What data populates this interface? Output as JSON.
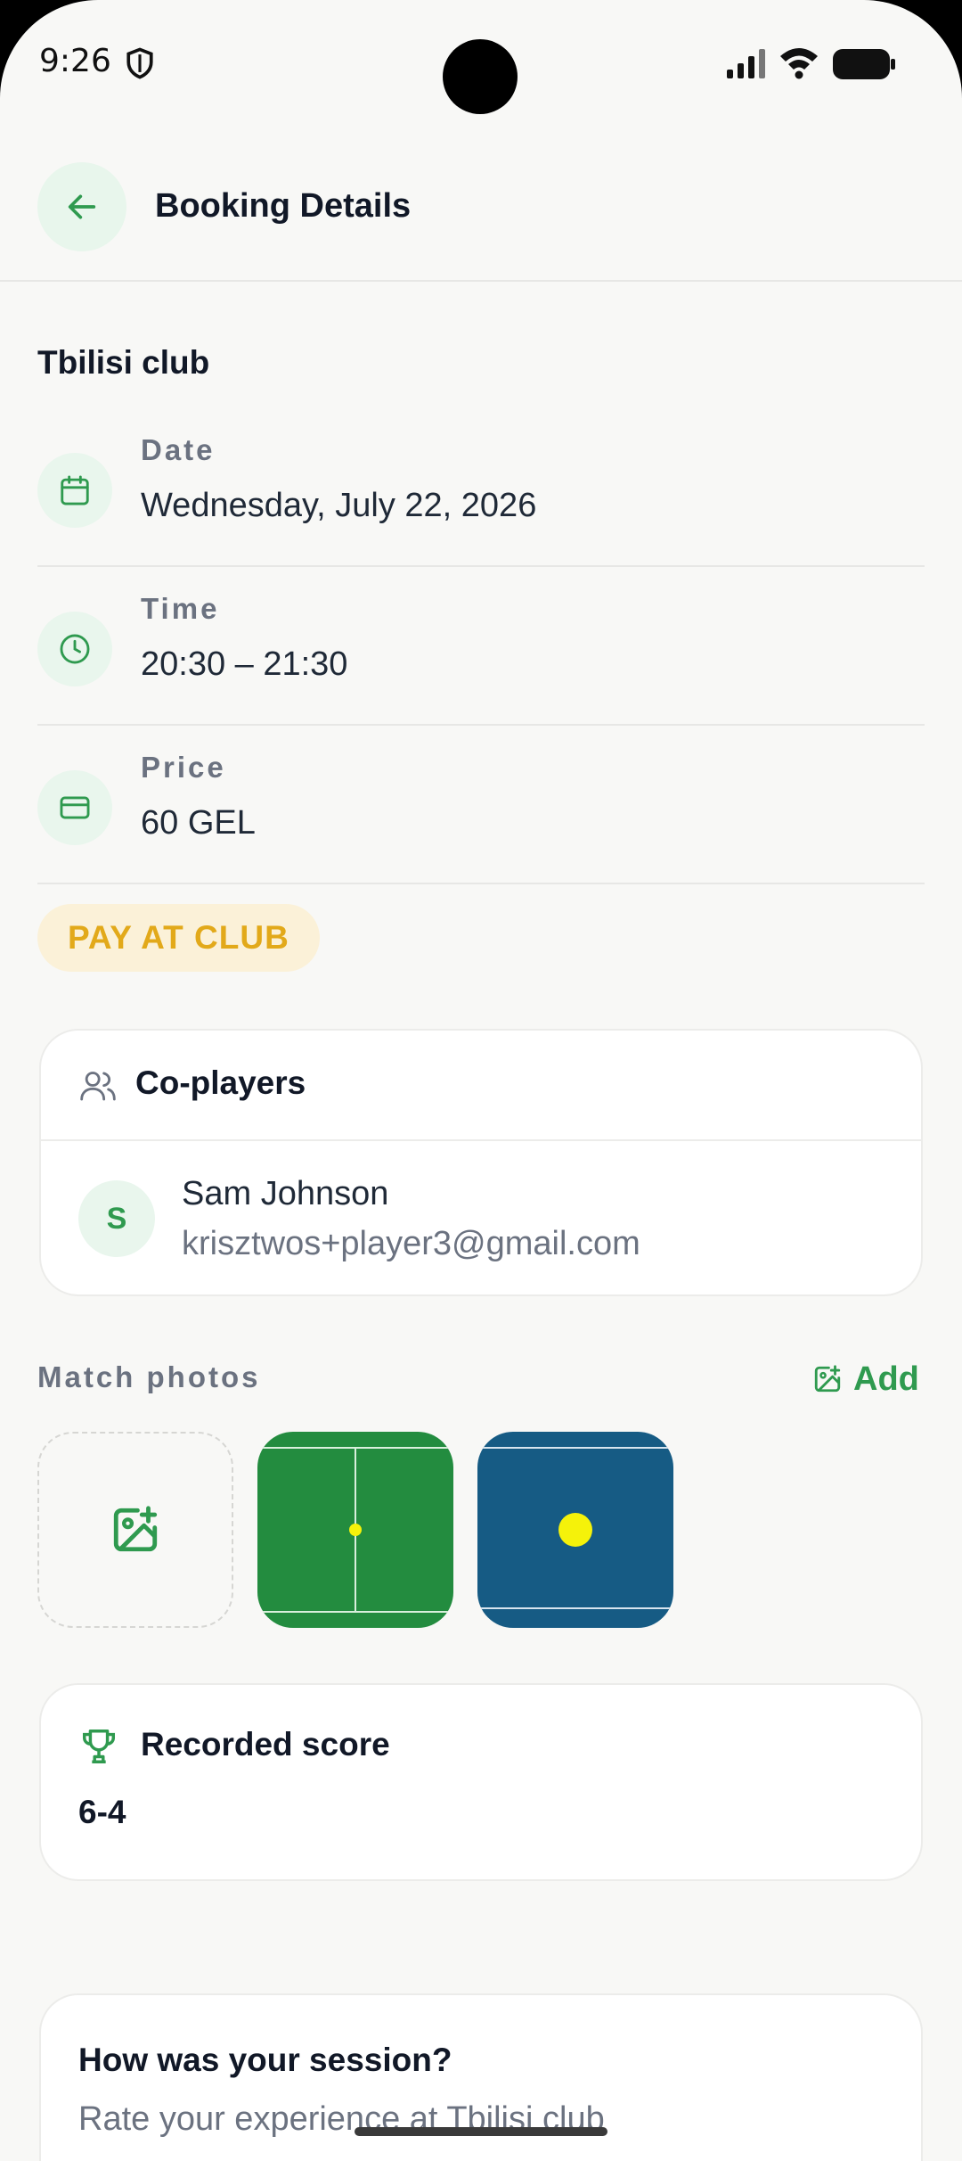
{
  "status_bar": {
    "time": "9:26"
  },
  "header": {
    "title": "Booking Details"
  },
  "club_name": "Tbilisi club",
  "details": [
    {
      "label": "Date",
      "value": "Wednesday, July 22, 2026",
      "icon": "calendar-icon"
    },
    {
      "label": "Time",
      "value": "20:30 – 21:30",
      "icon": "clock-icon"
    },
    {
      "label": "Price",
      "value": "60 GEL",
      "icon": "credit-card-icon"
    }
  ],
  "payment_badge": "PAY AT CLUB",
  "coplayers": {
    "title": "Co-players",
    "players": [
      {
        "initial": "S",
        "name": "Sam Johnson",
        "email": "krisztwos+player3@gmail.com"
      }
    ]
  },
  "photos": {
    "label": "Match photos",
    "add_label": "Add"
  },
  "score": {
    "title": "Recorded score",
    "value": "6-4"
  },
  "session": {
    "title": "How was your session?",
    "subtitle": "Rate your experience at Tbilisi club"
  },
  "colors": {
    "accent": "#2f9a4f",
    "badge_text": "#e2a91a",
    "badge_bg": "#fbf1d8",
    "background": "#f8f8f6"
  }
}
